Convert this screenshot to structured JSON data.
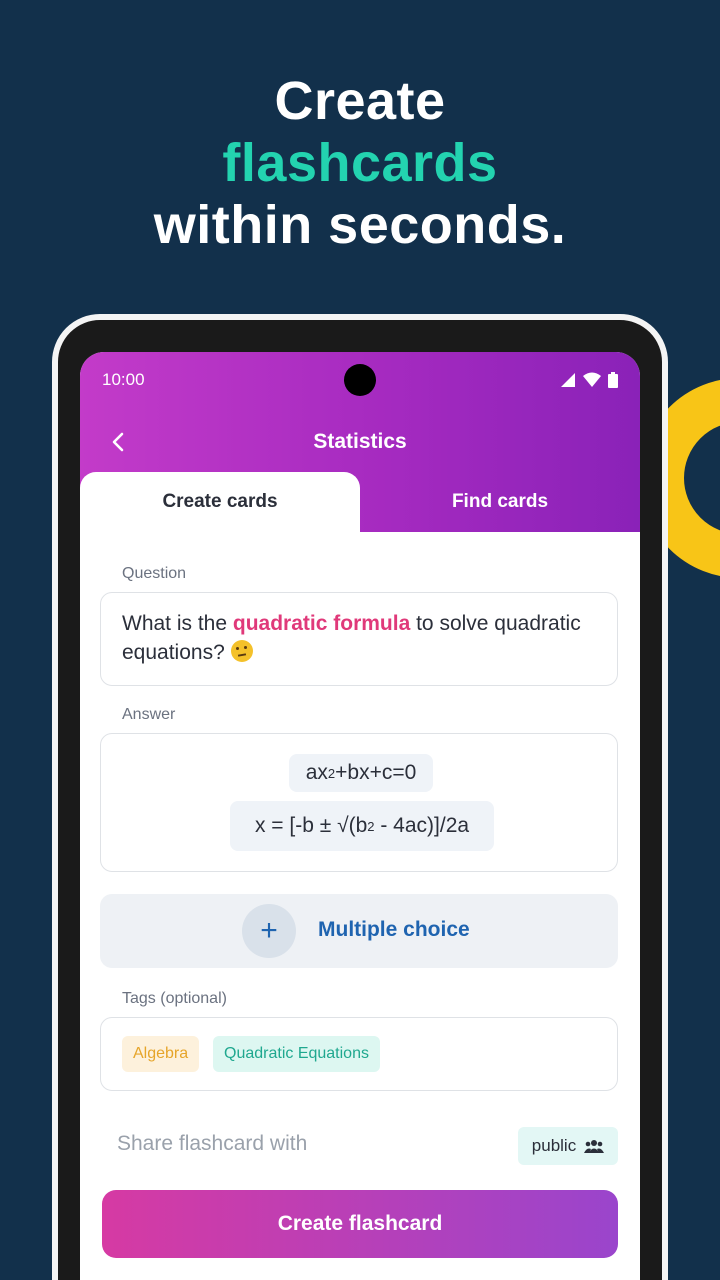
{
  "headline": {
    "line1": "Create",
    "line2": "flashcards",
    "line3": "within seconds."
  },
  "colors": {
    "background": "#12304b",
    "accent": "#23d3b0",
    "header_gradient_start": "#c33bc9",
    "header_gradient_end": "#8a22b8",
    "highlight": "#e0397a",
    "link_blue": "#1f64b0",
    "decoration_yellow": "#f8c517"
  },
  "status_bar": {
    "time": "10:00",
    "icons": [
      "signal-icon",
      "wifi-icon",
      "battery-icon"
    ]
  },
  "header": {
    "title": "Statistics",
    "back_icon": "chevron-left-icon"
  },
  "tabs": [
    {
      "label": "Create cards",
      "active": true
    },
    {
      "label": "Find cards",
      "active": false
    }
  ],
  "question": {
    "label": "Question",
    "text_before": "What is the ",
    "text_highlight": "quadratic formula",
    "text_after": " to solve quadratic equations?",
    "emoji": "thinking-face-icon"
  },
  "answer": {
    "label": "Answer",
    "line1_base": "ax",
    "line1_sup": "2",
    "line1_rest": "+bx+c=0",
    "line2_start": "x = [-b ± √(b",
    "line2_sup": "2",
    "line2_end": " - 4ac)]/2a"
  },
  "multiple_choice": {
    "label": "Multiple choice",
    "icon": "plus-icon"
  },
  "tags": {
    "label": "Tags (optional)",
    "items": [
      "Algebra",
      "Quadratic Equations"
    ]
  },
  "share": {
    "label": "Share flashcard with",
    "value": "public",
    "icon": "group-icon"
  },
  "create_button": {
    "label": "Create flashcard"
  }
}
